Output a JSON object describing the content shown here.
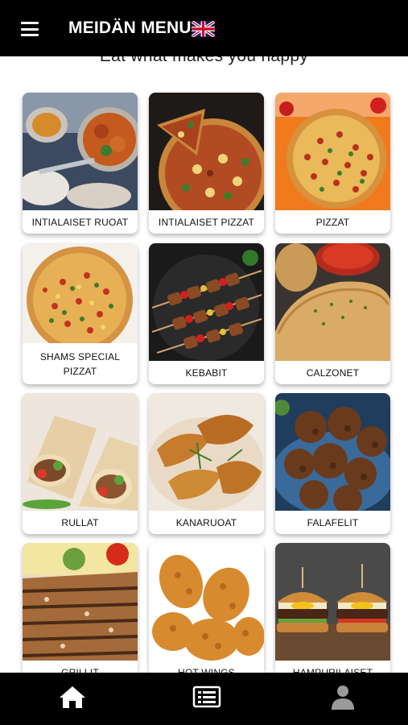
{
  "header": {
    "title": "MEIDÄN MENU",
    "menu_icon": "hamburger-menu-icon",
    "language_icon": "uk-flag-icon"
  },
  "tagline": "Eat what makes you happy",
  "categories": [
    {
      "label": "INTIALAISET RUOAT",
      "icon": "indian-curry-image"
    },
    {
      "label": "INTIALAISET PIZZAT",
      "icon": "indian-pizza-image"
    },
    {
      "label": "PIZZAT",
      "icon": "pizza-image"
    },
    {
      "label": "SHAMS SPECIAL PIZZAT",
      "icon": "special-pizza-image"
    },
    {
      "label": "KEBABIT",
      "icon": "kebab-skewers-image"
    },
    {
      "label": "CALZONET",
      "icon": "calzone-image"
    },
    {
      "label": "RULLAT",
      "icon": "wrap-roll-image"
    },
    {
      "label": "KANARUOAT",
      "icon": "chicken-dish-image"
    },
    {
      "label": "FALAFELIT",
      "icon": "falafel-image"
    },
    {
      "label": "GRILLIT",
      "icon": "grill-steak-image"
    },
    {
      "label": "HOT WINGS",
      "icon": "fried-chicken-image"
    },
    {
      "label": "HAMPURILAISET",
      "icon": "burger-image"
    }
  ],
  "bottom_nav": {
    "items": [
      {
        "icon": "home-icon"
      },
      {
        "icon": "menu-list-icon"
      },
      {
        "icon": "user-profile-icon"
      }
    ]
  },
  "colors": {
    "bar": "#000000",
    "background": "#ffffff"
  }
}
